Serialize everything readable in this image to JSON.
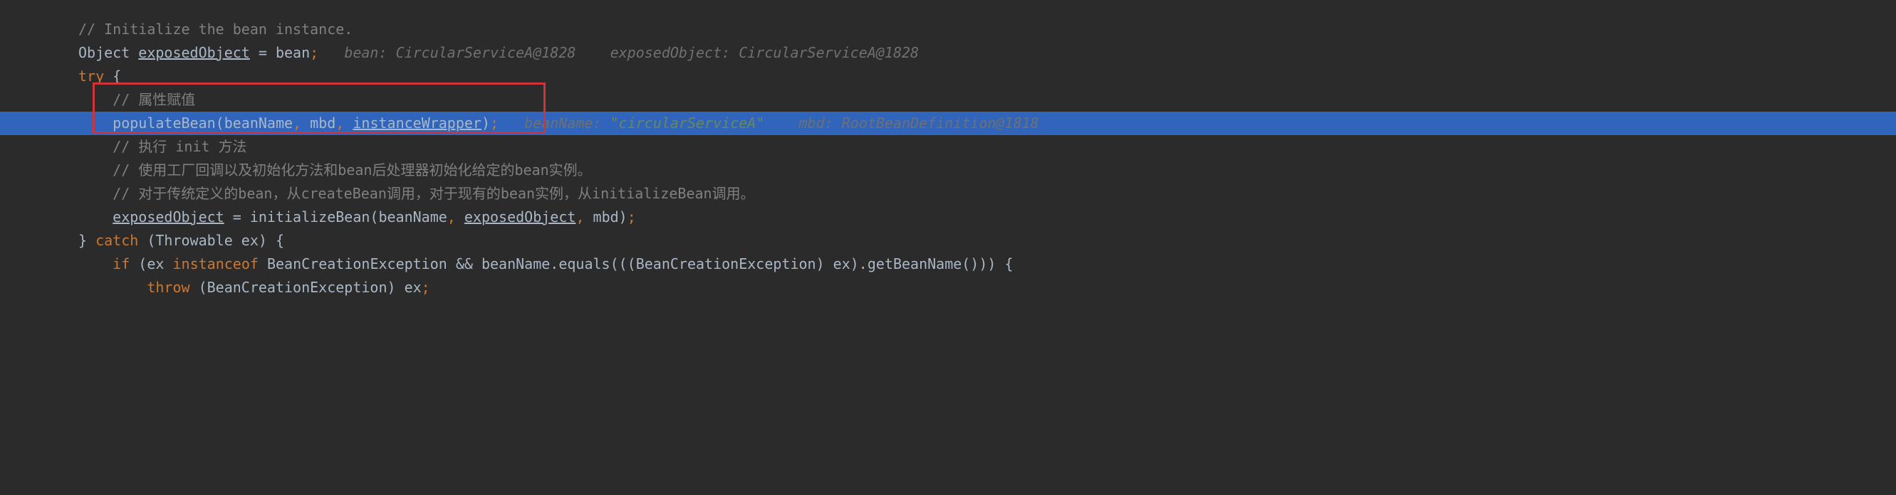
{
  "lines": {
    "l1_comment": "// Initialize the bean instance.",
    "l2_type": "Object ",
    "l2_var": "exposedObject",
    "l2_eq": " = bean",
    "l2_semi": ";   ",
    "l2_hint1a": "bean: ",
    "l2_hint1b": "CircularServiceA@1828",
    "l2_hint2a": "    exposedObject: ",
    "l2_hint2b": "CircularServiceA@1828",
    "l3_try": "try",
    "l3_brace": " {",
    "l4_comment": "    // 属性赋值",
    "l5_indent": "    ",
    "l5_method": "populateBean(beanName",
    "l5_c1": ", ",
    "l5_arg2": "mbd",
    "l5_c2": ", ",
    "l5_arg3": "instanceWrapper",
    "l5_close": ")",
    "l5_semi": ";   ",
    "l5_hint1a": "beanName: ",
    "l5_hint1s": "\"circularServiceA\"",
    "l5_hint2a": "    mbd: ",
    "l5_hint2b": "RootBeanDefinition@1818",
    "l6_comment": "    // 执行 init 方法",
    "l7_comment": "    // 使用工厂回调以及初始化方法和bean后处理器初始化给定的bean实例。",
    "l8_comment": "    // 对于传统定义的bean，从createBean调用，对于现有的bean实例，从initializeBean调用。",
    "l9_indent": "    ",
    "l9_var": "exposedObject",
    "l9_eq": " = initializeBean(beanName",
    "l9_c1": ", ",
    "l9_arg2": "exposedObject",
    "l9_c2": ", ",
    "l9_arg3": "mbd)",
    "l9_semi": ";",
    "l10_close": "} ",
    "l10_catch": "catch",
    "l10_paren": " (Throwable ex) {",
    "l11_indent": "    ",
    "l11_if": "if",
    "l11_cond1": " (ex ",
    "l11_instanceof": "instanceof",
    "l11_cond2": " BeanCreationException && beanName.equals(((BeanCreationException) ex).getBeanName())) {",
    "l12_indent": "        ",
    "l12_throw": "throw",
    "l12_expr": " (BeanCreationException) ex",
    "l12_semi": ";"
  }
}
